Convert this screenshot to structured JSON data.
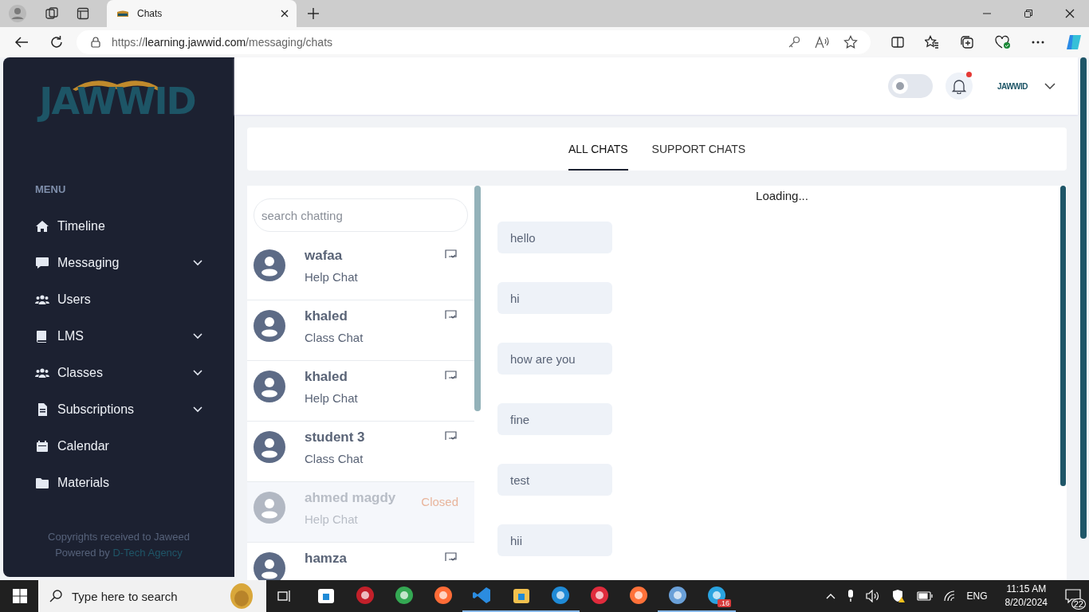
{
  "browser": {
    "tab_title": "Chats",
    "url_prefix": "https://",
    "url_host": "learning.jawwid.com",
    "url_path": "/messaging/chats"
  },
  "sidebar": {
    "logo": "JAWWID",
    "menu_title": "MENU",
    "items": [
      {
        "label": "Timeline",
        "expandable": false
      },
      {
        "label": "Messaging",
        "expandable": true
      },
      {
        "label": "Users",
        "expandable": false
      },
      {
        "label": "LMS",
        "expandable": true
      },
      {
        "label": "Classes",
        "expandable": true
      },
      {
        "label": "Subscriptions",
        "expandable": true
      },
      {
        "label": "Calendar",
        "expandable": false
      },
      {
        "label": "Materials",
        "expandable": false
      }
    ],
    "footer_line": "Copyrights received to Jaweed",
    "powered_by": "Powered by",
    "agency": "D-Tech Agency"
  },
  "header": {
    "dark_mode": false,
    "notification_unread": true,
    "account_logo": "JAWWID"
  },
  "tabs": [
    {
      "label": "ALL CHATS",
      "selected": true
    },
    {
      "label": "SUPPORT CHATS",
      "selected": false
    }
  ],
  "search": {
    "placeholder": "search chatting"
  },
  "chats": [
    {
      "name": "wafaa",
      "type": "Help Chat",
      "closed": false
    },
    {
      "name": "khaled",
      "type": "Class Chat",
      "closed": false
    },
    {
      "name": "khaled",
      "type": "Help Chat",
      "closed": false
    },
    {
      "name": "student 3",
      "type": "Class Chat",
      "closed": false
    },
    {
      "name": "ahmed magdy",
      "type": "Help Chat",
      "closed": true,
      "status": "Closed"
    },
    {
      "name": "hamza",
      "closed": false
    }
  ],
  "conversation": {
    "status": "Loading...",
    "messages": [
      "hello",
      "hi",
      "how are you",
      "fine",
      "test",
      "hii"
    ]
  },
  "taskbar": {
    "search_placeholder": "Type here to search",
    "apps": [
      {
        "running": false
      },
      {
        "running": false
      },
      {
        "running": false
      },
      {
        "running": false
      },
      {
        "running": true
      },
      {
        "running": true
      },
      {
        "running": true
      },
      {
        "running": false
      },
      {
        "running": false
      },
      {
        "running": true
      },
      {
        "running": true,
        "badge": ".16"
      }
    ],
    "language": "ENG",
    "time": "11:15 AM",
    "date": "8/20/2024",
    "notifications": "22"
  }
}
